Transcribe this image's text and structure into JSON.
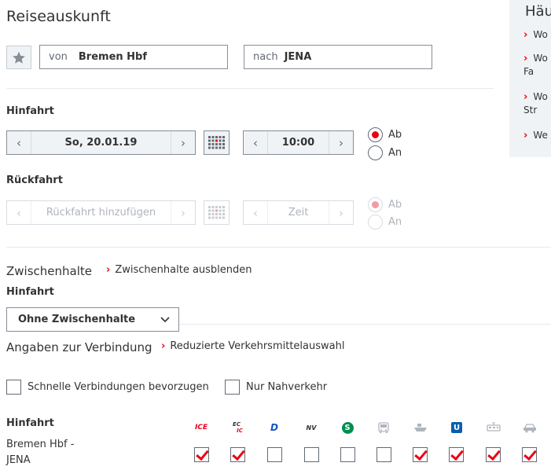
{
  "page": {
    "title": "Reiseauskunft"
  },
  "side": {
    "title": "Häu",
    "items": [
      "Wo",
      "Wo\nFa",
      "Wo\nStr",
      "We"
    ]
  },
  "route": {
    "from_label": "von",
    "from_value": "Bremen Hbf",
    "to_label": "nach",
    "to_value": "JENA"
  },
  "outbound": {
    "label": "Hinfahrt",
    "date": "So, 20.01.19",
    "time": "10:00",
    "radio_ab": "Ab",
    "radio_an": "An",
    "selected": "Ab"
  },
  "return": {
    "label": "Rückfahrt",
    "date_placeholder": "Rückfahrt hinzufügen",
    "time_placeholder": "Zeit",
    "radio_ab": "Ab",
    "radio_an": "An",
    "selected": "Ab"
  },
  "stops": {
    "heading": "Zwischenhalte",
    "toggle_link": "Zwischenhalte ausblenden",
    "sub_label": "Hinfahrt",
    "select_value": "Ohne Zwischenhalte"
  },
  "connection": {
    "heading": "Angaben zur Verbindung",
    "link": "Reduzierte Verkehrsmittelauswahl",
    "fast_label": "Schnelle Verbindungen bevorzugen",
    "fast_checked": false,
    "local_label": "Nur Nahverkehr",
    "local_checked": false
  },
  "products": {
    "section_label": "Hinfahrt",
    "route_line1": "Bremen Hbf -",
    "route_line2": "JENA",
    "items": [
      {
        "icon": "ice-icon",
        "label": "ICE",
        "checked": true
      },
      {
        "icon": "ec-ic-icon",
        "label_top": "EC",
        "label_bottom": "IC",
        "checked": true
      },
      {
        "icon": "d-train-icon",
        "label": "D",
        "checked": false
      },
      {
        "icon": "nv-icon",
        "label": "NV",
        "checked": false
      },
      {
        "icon": "s-bahn-icon",
        "label": "S",
        "checked": false
      },
      {
        "icon": "bus-icon",
        "checked": false
      },
      {
        "icon": "ship-icon",
        "checked": true
      },
      {
        "icon": "u-bahn-icon",
        "label": "U",
        "checked": true
      },
      {
        "icon": "tram-icon",
        "checked": true
      },
      {
        "icon": "taxi-icon",
        "checked": true
      }
    ]
  },
  "colors": {
    "accent": "#ec0016",
    "panel": "#f0f3f5",
    "border": "#878c96",
    "text": "#333333",
    "s_bahn": "#008d4f",
    "u_bahn": "#0a5fad",
    "d_train": "#1455c0"
  }
}
